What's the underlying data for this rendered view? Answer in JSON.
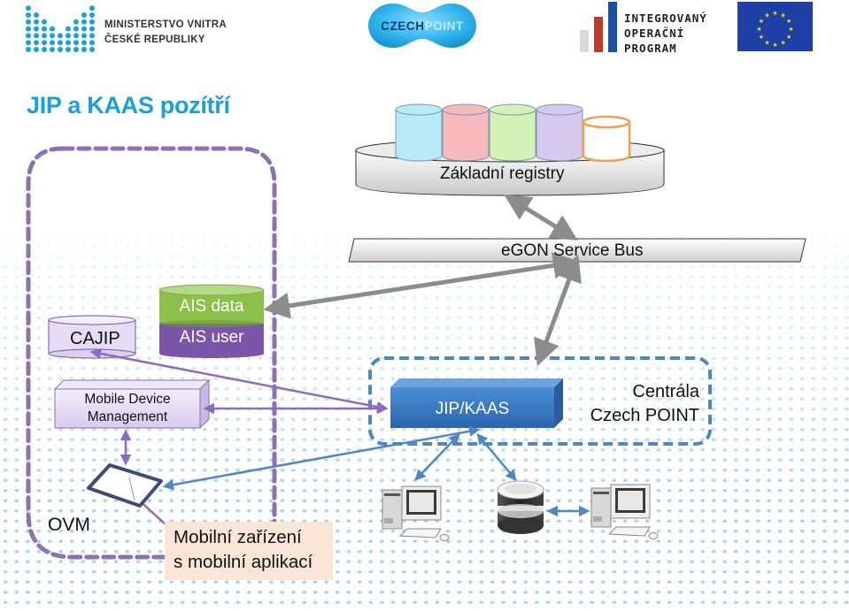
{
  "header": {
    "ministry_logo": {
      "icon": "ministry-dots-logo-icon",
      "line1": "MINISTERSTVO VNITRA",
      "line2": "ČESKÉ REPUBLIKY",
      "color": "#1aa0dc"
    },
    "czechpoint_logo": {
      "part1": "CZECH",
      "part2": "POINT",
      "color": "#1aa0dc"
    },
    "iop_logo": {
      "line1": "INTEGROVANÝ",
      "line2": "OPERAČNÍ",
      "line3": "PROGRAM",
      "bar_colors": [
        "#d9d9d9",
        "#c0392b",
        "#1e4fa8"
      ]
    },
    "eu_flag": {
      "icon": "eu-flag-icon",
      "color": "#1e3fa6",
      "star_color": "#ffdd00"
    }
  },
  "title": "JIP a KAAS pozítří",
  "diagram": {
    "registries": {
      "label": "Základní registry",
      "cylinder_colors": [
        "#b8eaf7",
        "#f7b8be",
        "#d4f2b5",
        "#d6c9ee",
        "#ffffff"
      ],
      "last_cylinder_border": "#f0a050"
    },
    "service_bus": {
      "label": "eGON Service Bus"
    },
    "ovm_group": {
      "label": "OVM",
      "border_color": "#8a72b4"
    },
    "cajip": {
      "label": "CAJIP"
    },
    "ais": {
      "data_label": "AIS data",
      "user_label": "AIS user",
      "data_color": "#8cc04b",
      "user_color": "#7a55a8"
    },
    "mdm": {
      "line1": "Mobile Device",
      "line2": "Management"
    },
    "central_group": {
      "line1": "Centrála",
      "line2": "Czech POINT",
      "border_color": "#4f86c4"
    },
    "jip_kaas": {
      "label": "JIP/KAAS",
      "color": "#3a78c2"
    },
    "mobile_device_note": {
      "line1": "Mobilní zařízení",
      "line2": "s mobilní aplikací"
    },
    "nodes": [
      {
        "name": "workstation-left",
        "icon": "desktop-computer-icon"
      },
      {
        "name": "database-server",
        "icon": "database-icon"
      },
      {
        "name": "workstation-right",
        "icon": "desktop-computer-icon"
      }
    ]
  }
}
